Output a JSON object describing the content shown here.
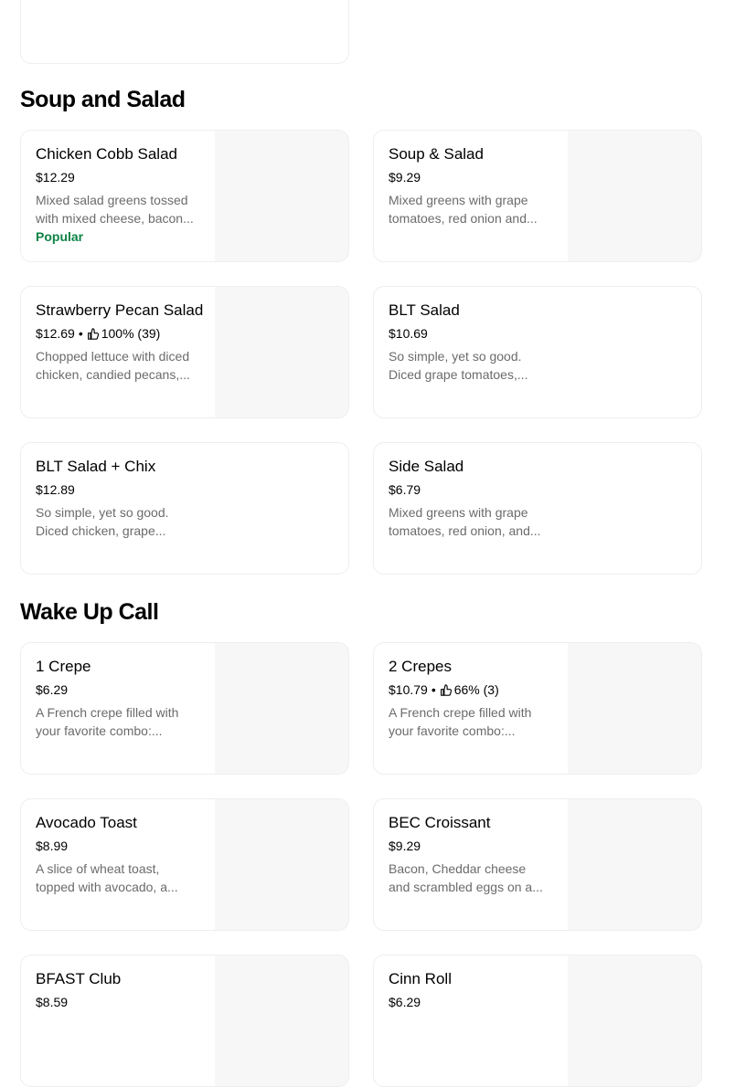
{
  "sections": [
    {
      "title": "Soup and Salad",
      "items": [
        {
          "name": "Chicken Cobb Salad",
          "price": "$12.29",
          "desc": "Mixed salad greens tossed with mixed cheese, bacon...",
          "badge": "Popular"
        },
        {
          "name": "Soup & Salad",
          "price": "$9.29",
          "desc": "Mixed greens with grape tomatoes, red onion and..."
        },
        {
          "name": "Strawberry Pecan Salad",
          "price": "$12.69",
          "rating": "100% (39)",
          "desc": "Chopped lettuce with diced chicken, candied pecans,..."
        },
        {
          "name": "BLT Salad",
          "price": "$10.69",
          "desc": "So simple, yet so good. Diced grape tomatoes,..."
        },
        {
          "name": "BLT Salad + Chix",
          "price": "$12.89",
          "desc": "So simple, yet so good. Diced chicken, grape..."
        },
        {
          "name": "Side Salad",
          "price": "$6.79",
          "desc": "Mixed greens with grape tomatoes, red onion, and..."
        }
      ]
    },
    {
      "title": "Wake Up Call",
      "items": [
        {
          "name": "1 Crepe",
          "price": "$6.29",
          "desc": "A French crepe filled with your favorite combo:..."
        },
        {
          "name": "2 Crepes",
          "price": "$10.79",
          "rating": "66% (3)",
          "desc": "A French crepe filled with your favorite combo:..."
        },
        {
          "name": "Avocado Toast",
          "price": "$8.99",
          "desc": "A slice of wheat toast, topped with avocado, a..."
        },
        {
          "name": "BEC Croissant",
          "price": "$9.29",
          "desc": "Bacon, Cheddar cheese and scrambled eggs on a..."
        },
        {
          "name": "BFAST Club",
          "price": "$8.59"
        },
        {
          "name": "Cinn Roll",
          "price": "$6.29"
        }
      ]
    }
  ],
  "icons": {
    "rating": "thumbs-up-icon"
  },
  "colors": {
    "popular": "#0e8345",
    "description": "#6b6b6b",
    "image_placeholder": "#f7f7f7",
    "card_border": "#eeeeee"
  }
}
